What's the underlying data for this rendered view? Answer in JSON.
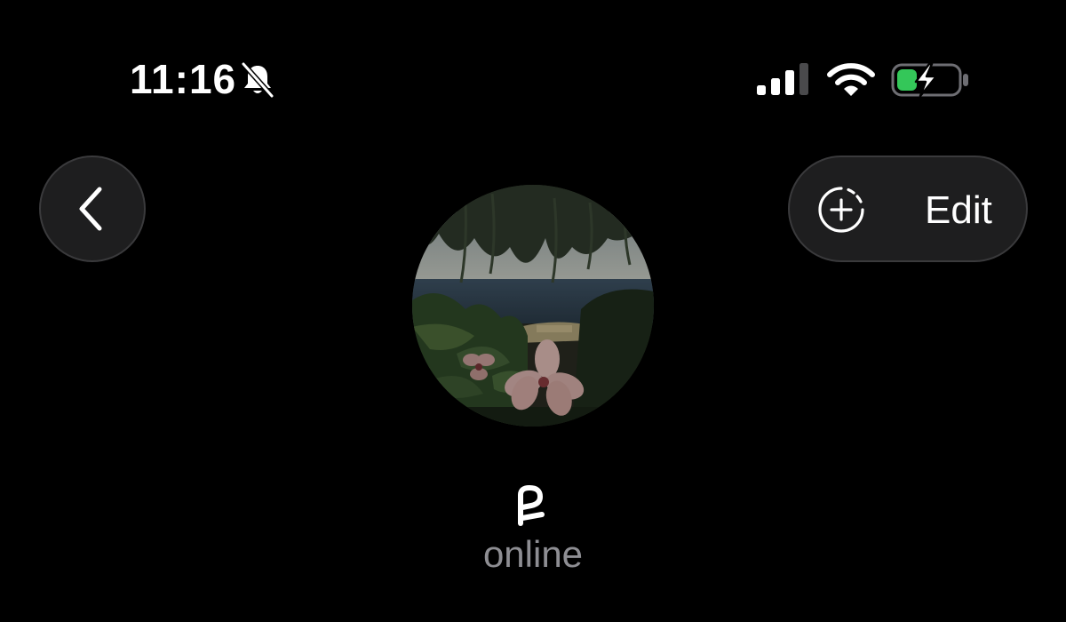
{
  "status_bar": {
    "time": "11:16",
    "bell_icon": "bell-slash-icon",
    "signal_icon": "cellular-signal-icon",
    "wifi_icon": "wifi-icon",
    "battery_icon": "battery-charging-icon",
    "battery_color": "#34c759"
  },
  "nav": {
    "back_icon": "chevron-left-icon",
    "edit_icon": "add-circle-dashed-icon",
    "edit_label": "Edit"
  },
  "profile": {
    "avatar_description_icon": "profile-photo",
    "name_glyph_icon": "name-glyph-icon",
    "status": "online"
  },
  "colors": {
    "background": "#000000",
    "button_fill": "#1e1e1f",
    "button_border": "#3a3a3c",
    "status_text": "#8e8e93"
  }
}
